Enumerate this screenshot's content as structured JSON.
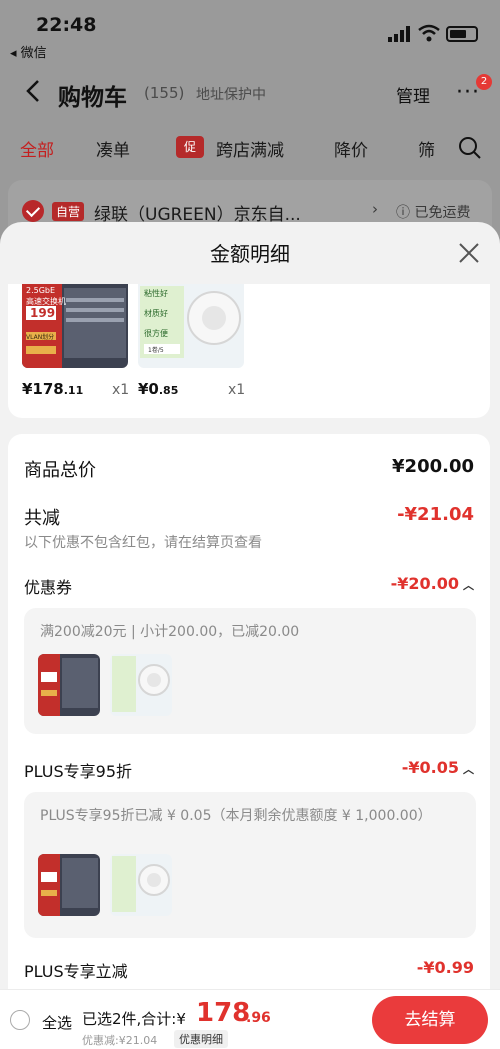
{
  "status_bar": {
    "time": "22:48",
    "back_app": "◂ 微信"
  },
  "nav": {
    "title": "购物车",
    "count": "(155)",
    "address": "地址保护中",
    "manage": "管理",
    "more": "···",
    "badge": "2"
  },
  "tabs": {
    "all": "全部",
    "bundle": "凑单",
    "promo_chip": "促",
    "cross_store": "跨店满减",
    "price_drop": "降价",
    "filter": "筛"
  },
  "shop": {
    "tag": "自营",
    "name": "绿联（UGREEN）京东自...",
    "arrow": "›",
    "shipping": "ⓘ 已免运费"
  },
  "sheet": {
    "title": "金额明细",
    "products": [
      {
        "price_int": "¥178",
        "price_dec": ".11",
        "qty": "x1",
        "thumb_lines": [
          "2.5GbE",
          "高速交换机"
        ],
        "thumb_price": "199",
        "thumb_tag": "VLAN划分"
      },
      {
        "price_int": "¥0",
        "price_dec": ".85",
        "qty": "x1",
        "thumb_lines": [
          "粘性好",
          "材质好",
          "很方便"
        ],
        "thumb_price": "",
        "thumb_tag": "1卷/5"
      }
    ],
    "total_label": "商品总价",
    "total_value": "¥200.00",
    "reduce_label": "共减",
    "reduce_value": "-¥21.04",
    "note": "以下优惠不包含红包，请在结算页查看",
    "coupon_label": "优惠券",
    "coupon_value": "-¥20.00",
    "coupon_desc": "满200减20元 | 小计200.00，已减20.00",
    "plus_label": "PLUS专享95折",
    "plus_value": "-¥0.05",
    "plus_desc": "PLUS专享95折已减 ¥ 0.05（本月剩余优惠额度 ¥ 1,000.00）",
    "plus_instant_label": "PLUS专享立减",
    "plus_instant_value": "-¥0.99"
  },
  "bottom": {
    "select_all": "全选",
    "summary": "已选2件,合计:¥",
    "total_int": "178",
    "total_dec": ".96",
    "discount": "优惠减:¥21.04",
    "detail_chip": "优惠明细",
    "checkout": "去结算"
  }
}
